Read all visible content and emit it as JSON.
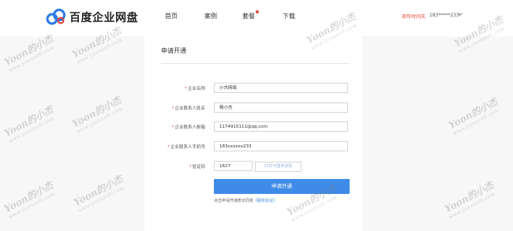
{
  "header": {
    "brand": "百度企业网盘",
    "nav": [
      {
        "label": "首页"
      },
      {
        "label": "案例"
      },
      {
        "label": "套餐"
      },
      {
        "label": "下载"
      }
    ],
    "notice": "周年时间庆",
    "user_phone": "183*****233"
  },
  "form": {
    "title": "申请开通",
    "rows": [
      {
        "label": "企业名称",
        "value": "小杰网络"
      },
      {
        "label": "企业联系人姓名",
        "value": "杨小杰"
      },
      {
        "label": "企业联系人邮箱",
        "value": "1174915111@qq.com"
      },
      {
        "label": "企业联系人手机号",
        "value": "183xxxxxx233"
      },
      {
        "label": "验证码",
        "value": "1627"
      }
    ],
    "resend_label": "31秒可重新获取",
    "submit_label": "申请开通",
    "agree_text": "点击申请开通表示同意",
    "agree_link": "《服务协议》"
  },
  "watermark": {
    "text": "Yoon的小杰",
    "url": "www.yoonsoft.com"
  },
  "colors": {
    "accent": "#3f8ce8",
    "required": "#e74c3c",
    "background": "#f7f7f8"
  }
}
